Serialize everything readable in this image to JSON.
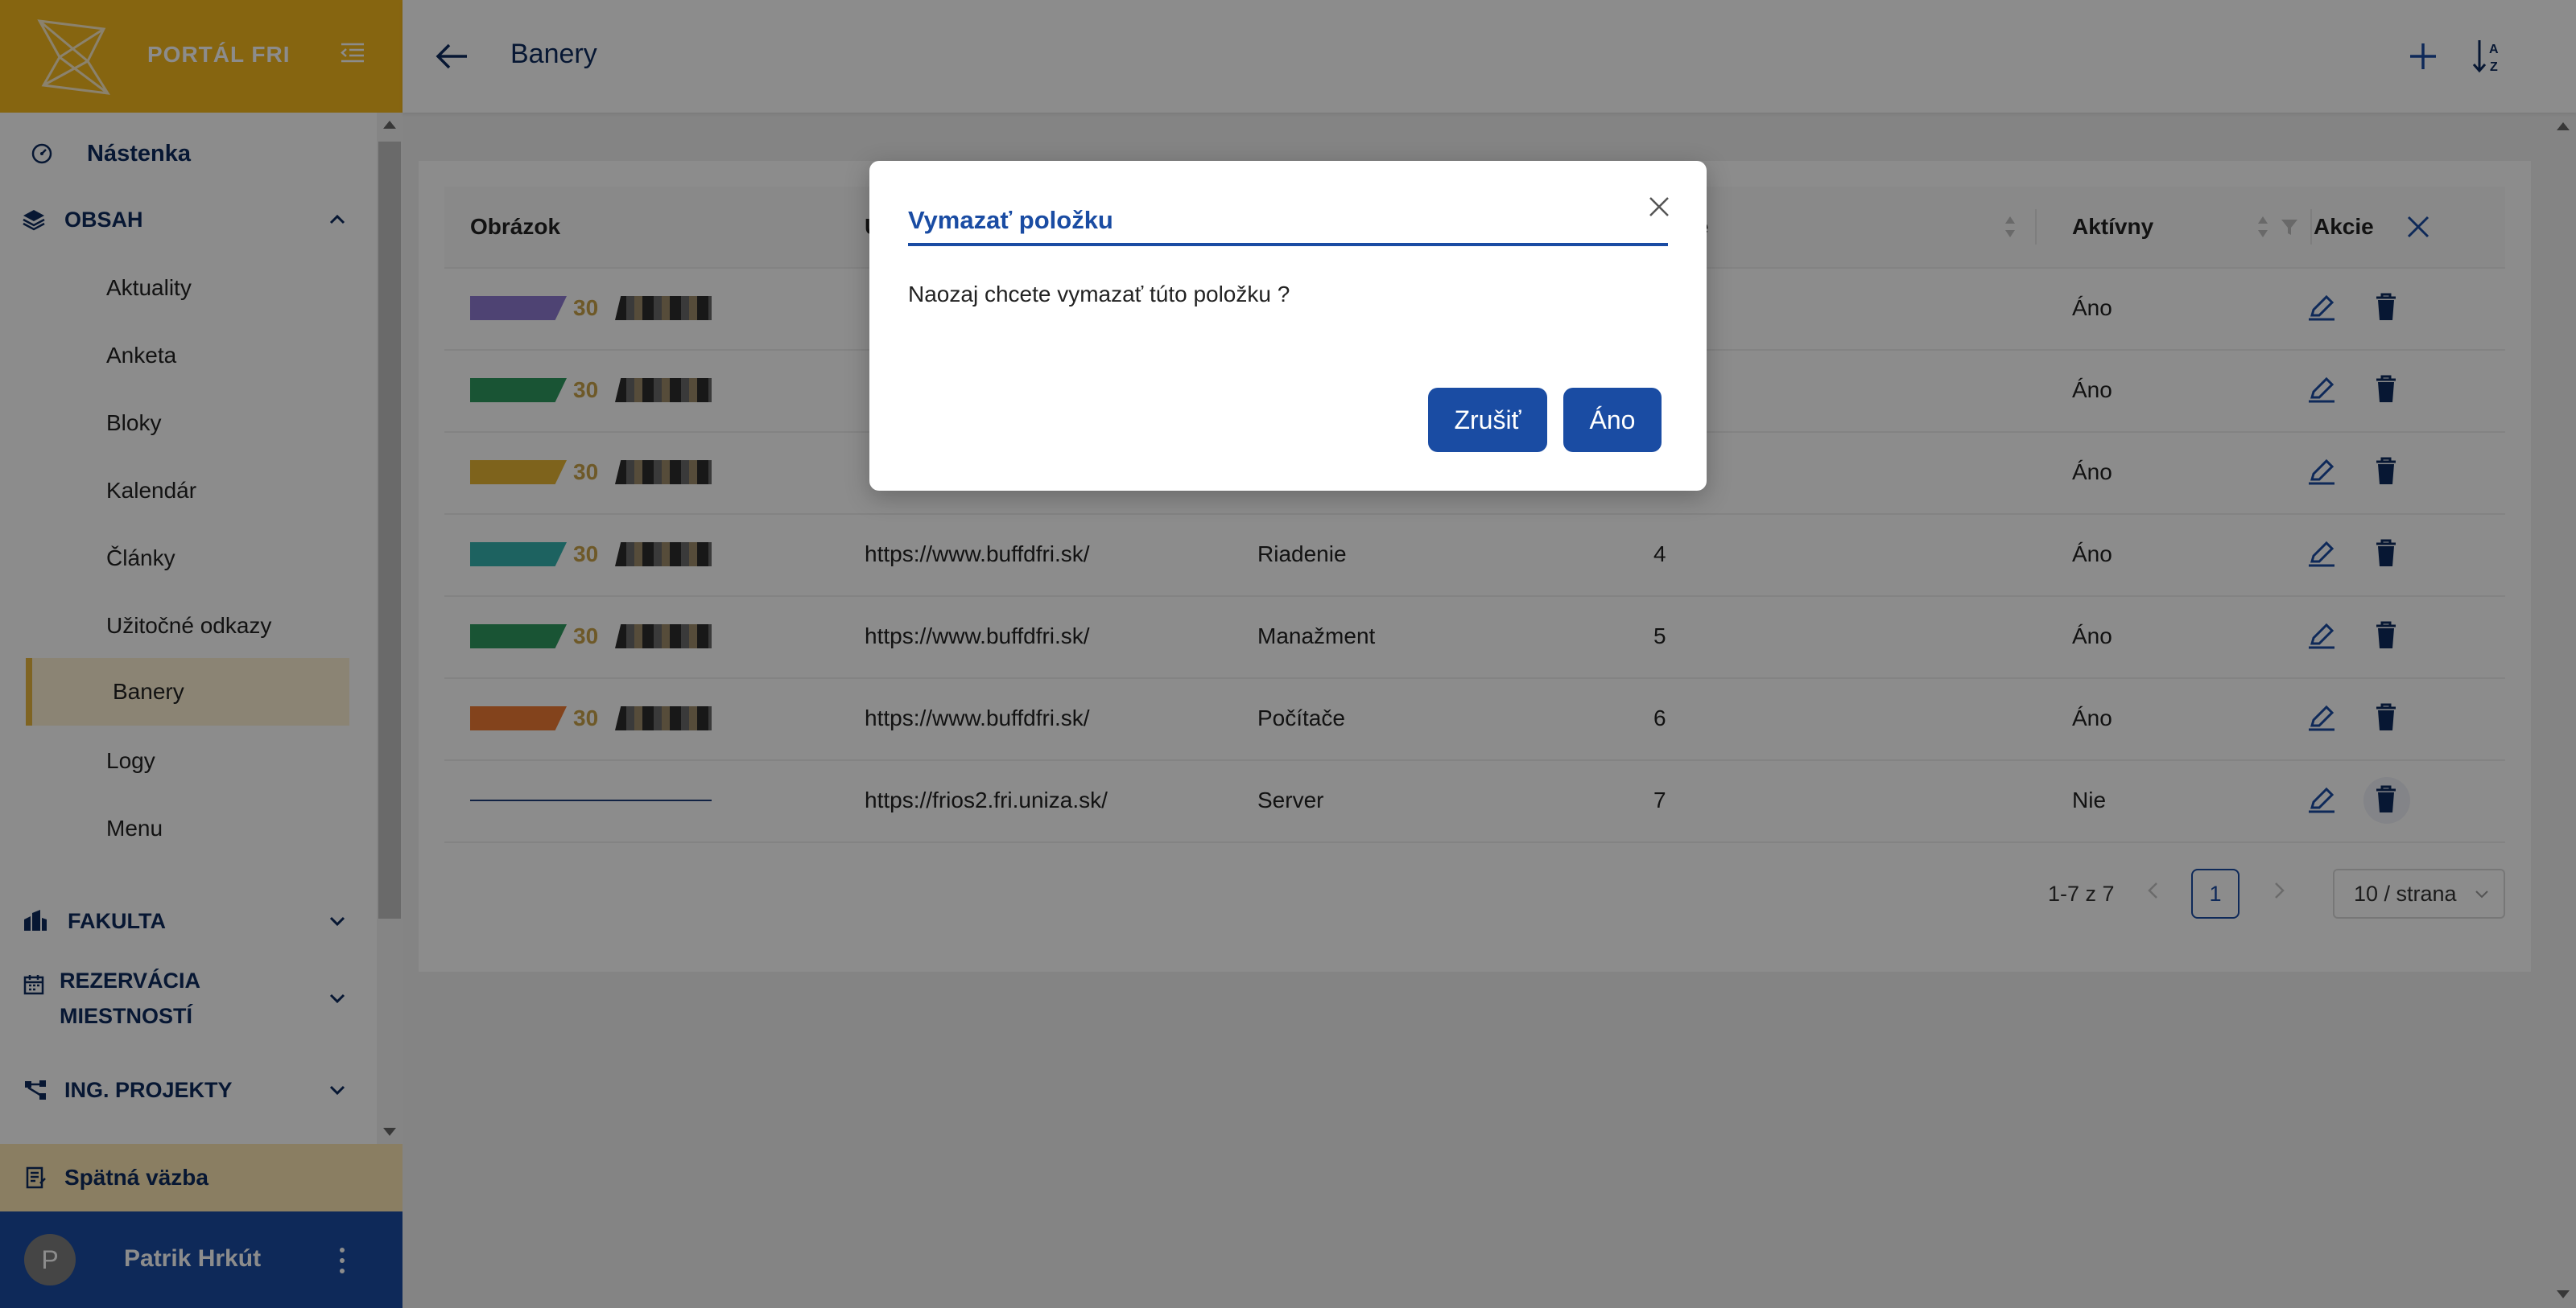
{
  "brand": {
    "title": "PORTÁL FRI"
  },
  "sidebar": {
    "dashboard": "Nástenka",
    "content_section": "OBSAH",
    "content_items": [
      "Aktuality",
      "Anketa",
      "Bloky",
      "Kalendár",
      "Články",
      "Užitočné odkazy",
      "Banery",
      "Logy",
      "Menu"
    ],
    "active_item": "Banery",
    "sections": [
      "FAKULTA",
      "REZERVÁCIA",
      "MIESTNOSTÍ",
      "ING. PROJEKTY"
    ],
    "feedback": "Spätná väzba",
    "user": {
      "initial": "P",
      "name": "Patrik Hrkút"
    }
  },
  "header": {
    "title": "Banery"
  },
  "table": {
    "columns": {
      "image": "Obrázok",
      "url_partial": "U",
      "order_partial": "die",
      "active": "Aktívny",
      "actions": "Akcie"
    },
    "rows": [
      {
        "url": "",
        "name": "",
        "order": "",
        "active": "Áno",
        "thumb_color": "#8f7ad1"
      },
      {
        "url": "",
        "name": "",
        "order": "",
        "active": "Áno",
        "thumb_color": "#2f9a5f"
      },
      {
        "url": "",
        "name": "",
        "order": "",
        "active": "Áno",
        "thumb_color": "#e6b534"
      },
      {
        "url": "https://www.buffdfri.sk/",
        "name": "Riadenie",
        "order": "4",
        "active": "Áno",
        "thumb_color": "#36b3b0"
      },
      {
        "url": "https://www.buffdfri.sk/",
        "name": "Manažment",
        "order": "5",
        "active": "Áno",
        "thumb_color": "#2f9a5f"
      },
      {
        "url": "https://www.buffdfri.sk/",
        "name": "Počítače",
        "order": "6",
        "active": "Áno",
        "thumb_color": "#ee7a33"
      },
      {
        "url": "https://frios2.fri.uniza.sk/",
        "name": "Server",
        "order": "7",
        "active": "Nie",
        "thumb_color": ""
      }
    ]
  },
  "pagination": {
    "summary": "1-7 z 7",
    "current_page": "1",
    "page_size": "10 / strana"
  },
  "modal": {
    "title": "Vymazať položku",
    "message": "Naozaj chcete vymazať túto položku ?",
    "cancel_label": "Zrušiť",
    "confirm_label": "Áno"
  },
  "colors": {
    "brand_yellow": "#f5b81e",
    "primary_blue": "#1a4ca3",
    "navy": "#0d2b5e"
  },
  "icons": [
    "dashboard-icon",
    "layers-icon",
    "building-icon",
    "calendar-icon",
    "network-icon",
    "feedback-icon",
    "arrow-left-icon",
    "plus-icon",
    "sort-az-icon",
    "edit-icon",
    "trash-icon",
    "close-icon",
    "filter-icon"
  ]
}
